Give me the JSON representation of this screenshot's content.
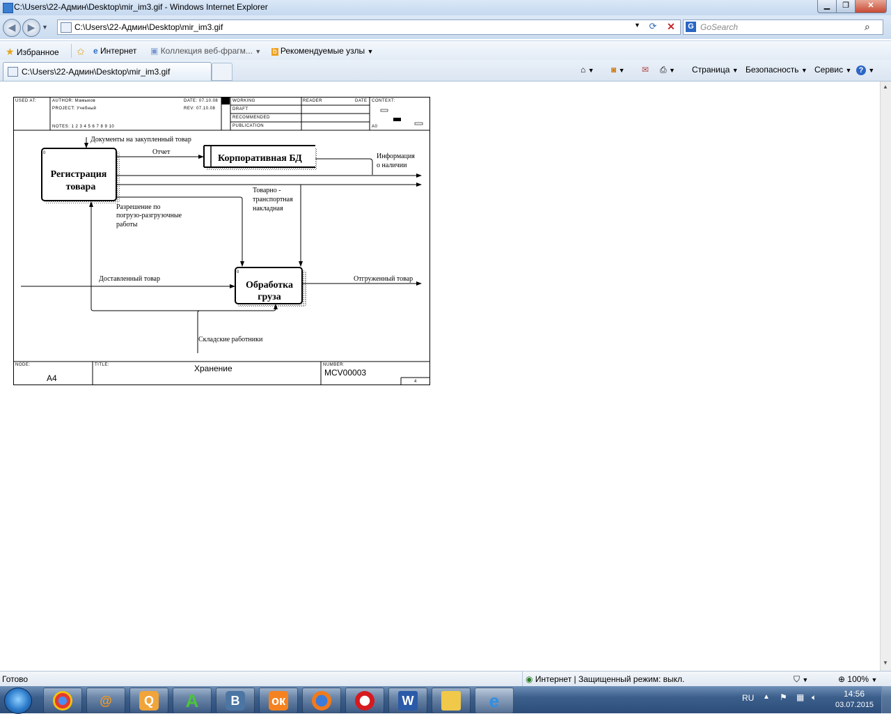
{
  "window": {
    "title": "C:\\Users\\22-Админ\\Desktop\\mir_im3.gif - Windows Internet Explorer"
  },
  "address": {
    "url": "C:\\Users\\22-Админ\\Desktop\\mir_im3.gif"
  },
  "search": {
    "placeholder": "GoSearch"
  },
  "favorites_bar": {
    "favorites_label": "Избранное",
    "internet_label": "Интернет",
    "webslices_label": "Коллекция веб-фрагм...",
    "suggested_label": "Рекомендуемые узлы"
  },
  "tab": {
    "label": "C:\\Users\\22-Админ\\Desktop\\mir_im3.gif"
  },
  "command_bar": {
    "page_label": "Страница",
    "safety_label": "Безопасность",
    "tools_label": "Сервис"
  },
  "diagram": {
    "header": {
      "used_at": "USED AT:",
      "author": "AUTHOR: Мамыков",
      "project": "PROJECT: Учебный",
      "notes": "NOTES: 1 2 3 4 5 6 7 8 9 10",
      "date": "DATE: 07.10.08",
      "rev": "REV: 07.10.08",
      "working": "WORKING",
      "draft": "DRAFT",
      "recommended": "RECOMMENDED",
      "publication": "PUBLICATION",
      "reader": "READER",
      "reader_date": "DATE",
      "context": "CONTEXT:",
      "context_node": "A0"
    },
    "boxes": {
      "registration": "Регистрация товара",
      "registration_num": "0",
      "processing": "Обработка груза",
      "processing_num": "0",
      "datastore": "Корпоративная БД"
    },
    "arrows": {
      "docs": "Документы на закупленный товар",
      "report": "Отчет",
      "info_1": "Информация",
      "info_2": "о наличии",
      "waybill_1": "Товарно -",
      "waybill_2": "транспортная",
      "waybill_3": "накладная",
      "permit_1": "Разрешение по",
      "permit_2": "погрузо-разгрузочные",
      "permit_3": "работы",
      "delivered": "Доставленный товар",
      "shipped": "Отгруженный товар",
      "workers": "Складские работники"
    },
    "footer": {
      "node_label": "NODE:",
      "node": "A4",
      "title_label": "TITLE:",
      "title": "Хранение",
      "number_label": "NUMBER:",
      "number": "MCV00003",
      "page": "4"
    }
  },
  "status": {
    "left": "Готово",
    "zone": "Интернет | Защищенный режим: выкл.",
    "zoom": "100%"
  },
  "taskbar": {
    "lang": "RU",
    "time": "14:56",
    "date": "03.07.2015"
  }
}
